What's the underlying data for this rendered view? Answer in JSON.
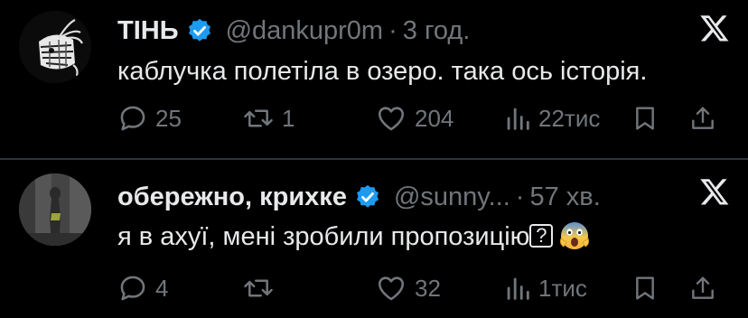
{
  "posts": [
    {
      "author_name": "ТІНЬ",
      "handle": "@dankupr0m",
      "separator": "·",
      "time": "3 год.",
      "text": "каблучка полетіла в озеро. така ось історія.",
      "replies": "25",
      "reposts": "1",
      "likes": "204",
      "views": "22тис",
      "verified": true,
      "avatar_icon": "stitched-mask-icon"
    },
    {
      "author_name": "обережно, крихке",
      "handle": "@sunny...",
      "separator": "·",
      "time": "57 хв.",
      "text": "я в ахуї, мені зробили пропозицію",
      "text_glyph": "?",
      "text_emoji": "face-screaming-in-fear",
      "replies": "4",
      "reposts": "",
      "likes": "32",
      "views": "1тис",
      "verified": true,
      "avatar_icon": "person-photo"
    }
  ],
  "colors": {
    "background": "#000000",
    "text": "#e7e9ea",
    "muted": "#71767b",
    "verified": "#1d9bf0",
    "divider": "#2f3336"
  },
  "icons": {
    "close": "x-logo-icon",
    "reply": "reply-icon",
    "repost": "repost-icon",
    "like": "heart-icon",
    "views": "views-icon",
    "bookmark": "bookmark-icon",
    "share": "share-icon"
  }
}
